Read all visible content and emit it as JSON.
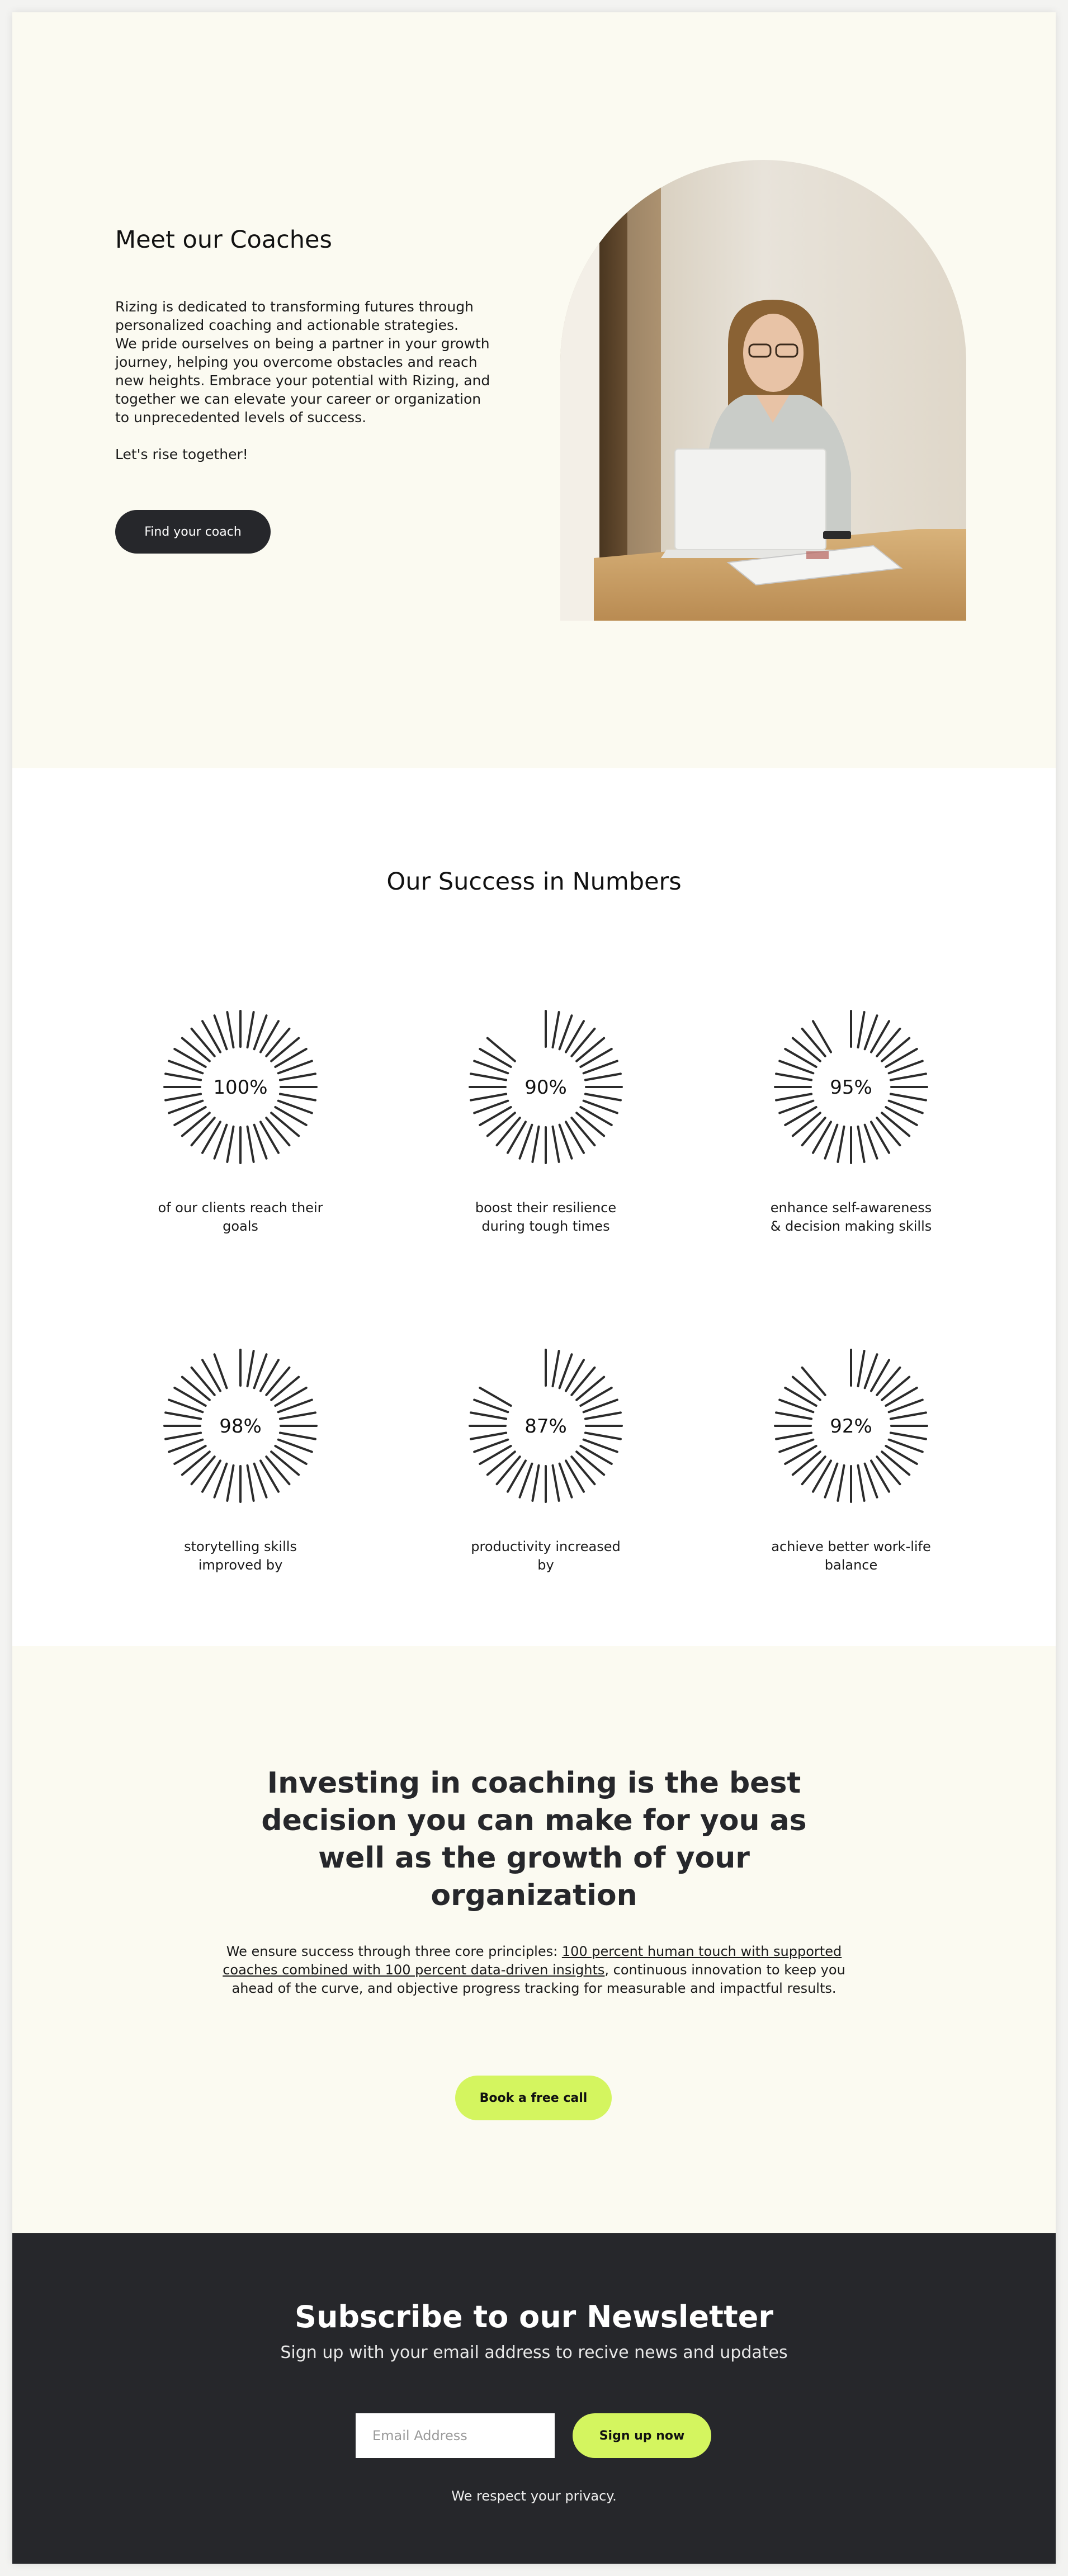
{
  "hero": {
    "title": "Meet our Coaches",
    "paragraph_1": "Rizing is dedicated to transforming futures through personalized coaching and actionable strategies.",
    "paragraph_2": "We pride ourselves on being a partner in your growth journey, helping you overcome obstacles and reach new heights. Embrace your potential with Rizing, and together we can elevate your career or organization to unprecedented levels of success.",
    "paragraph_3": "Let's rise together!",
    "button_label": "Find your coach"
  },
  "stats": {
    "title": "Our Success in Numbers",
    "items": [
      {
        "percent": 100,
        "value_label": "100%",
        "label": "of our clients reach their goals"
      },
      {
        "percent": 90,
        "value_label": "90%",
        "label": "boost their resilience during tough times"
      },
      {
        "percent": 95,
        "value_label": "95%",
        "label": "enhance self-awareness & decision making skills"
      },
      {
        "percent": 98,
        "value_label": "98%",
        "label": "storytelling skills improved by"
      },
      {
        "percent": 87,
        "value_label": "87%",
        "label": "productivity increased by"
      },
      {
        "percent": 92,
        "value_label": "92%",
        "label": "achieve better work-life balance"
      }
    ]
  },
  "invest": {
    "heading": "Investing in coaching is the best decision you can make for you as well as the growth of your organization",
    "text_before": "We ensure success through three core principles: ",
    "text_link": "100 percent human touch with supported coaches combined with 100 percent data-driven insights",
    "text_after": ", continuous innovation to keep you ahead of the curve, and objective progress tracking for measurable and impactful results.",
    "button_label": "Book a free call"
  },
  "newsletter": {
    "title": "Subscribe to our Newsletter",
    "subtitle": "Sign up with your email address to recive news and updates",
    "email_placeholder": "Email Address",
    "button_label": "Sign up now",
    "privacy": "We respect your privacy."
  },
  "colors": {
    "cream": "#fbfaf1",
    "dark": "#26272b",
    "lime": "#d4f55f"
  }
}
